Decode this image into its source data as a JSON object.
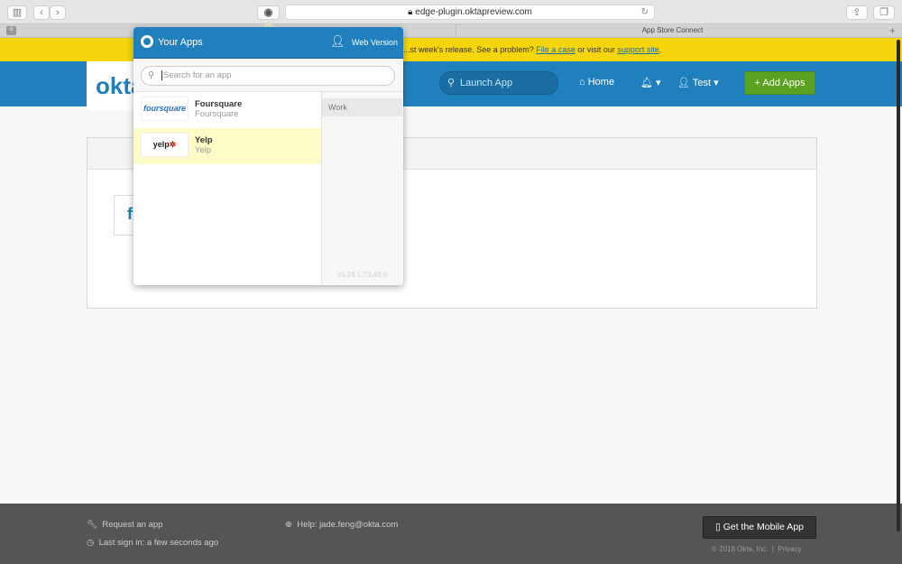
{
  "browser": {
    "url": "edge-plugin.oktapreview.com",
    "tab_active": "App Store Connect"
  },
  "banner": {
    "text_before": "...st week's release. See a problem?",
    "link1": "File a case",
    "text_mid": "or visit our",
    "link2": "support site",
    "text_after": "."
  },
  "header": {
    "logo": "okta",
    "launch_placeholder": "Launch App",
    "home": "Home",
    "user": "Test",
    "add_apps": "Add Apps"
  },
  "popup": {
    "title": "Your Apps",
    "web_version": "Web Version",
    "search_placeholder": "Search for an app",
    "apps": [
      {
        "name": "Foursquare",
        "subtitle": "Foursquare",
        "logo": "foursquare"
      },
      {
        "name": "Yelp",
        "subtitle": "Yelp",
        "logo": "yelp"
      }
    ],
    "category": "Work",
    "version": "v5.24.1.73.48.0"
  },
  "footer": {
    "request": "Request an app",
    "last_sign_in": "Last sign in: a few seconds ago",
    "help": "Help: jade.feng@okta.com",
    "mobile": "Get the Mobile App",
    "copyright": "© 2018 Okta, Inc.",
    "privacy": "Privacy"
  },
  "colors": {
    "brand": "#1f80bd",
    "banner": "#f5d50b",
    "add": "#5aa021",
    "highlight": "#fdfbc6"
  }
}
